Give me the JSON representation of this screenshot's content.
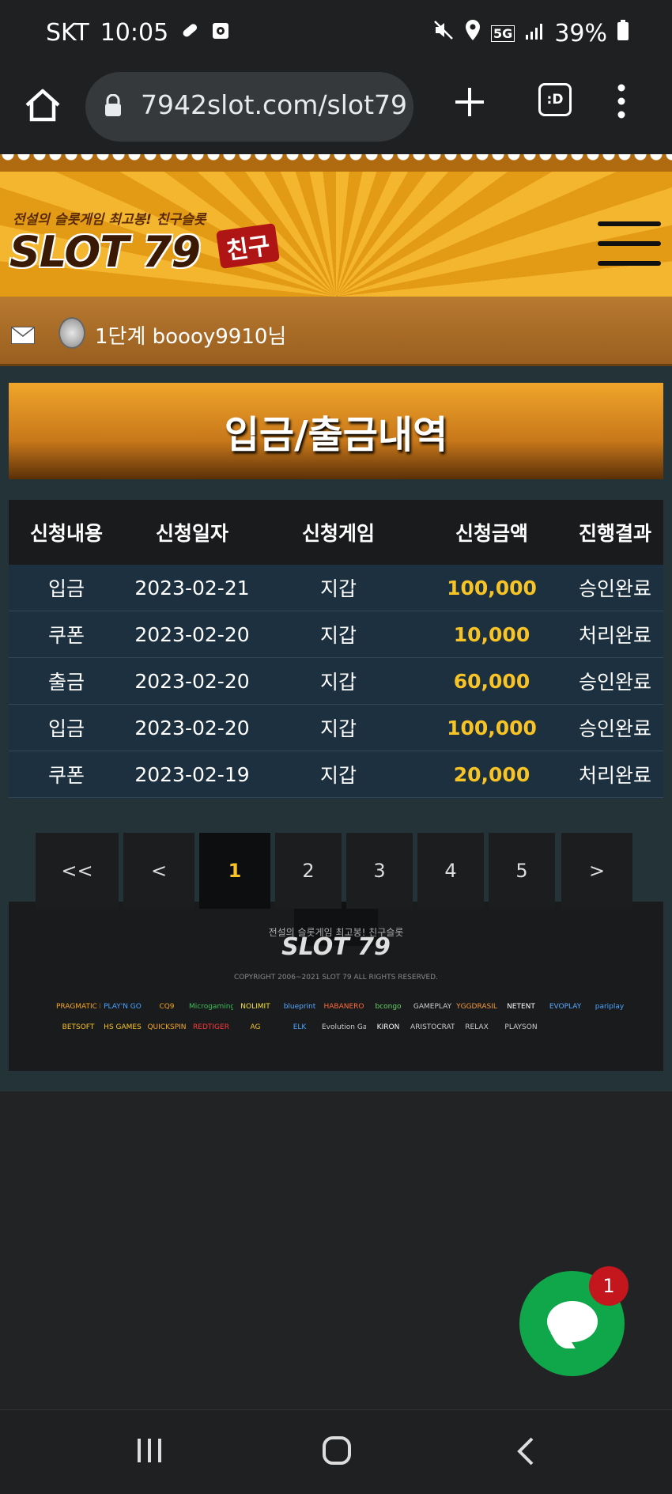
{
  "status_bar": {
    "carrier": "SKT",
    "time": "10:05",
    "network": "5G",
    "battery": "39%"
  },
  "browser": {
    "url": "7942slot.com/slot79",
    "tabs_label": ":D"
  },
  "site": {
    "slogan": "전설의 슬롯게임 최고봉! 친구슬롯",
    "logo_text": "SLOT 79",
    "logo_badge": "친구",
    "user_info": "1단계 boooy9910님"
  },
  "page_title": "입금/출금내역",
  "table": {
    "headers": [
      "신청내용",
      "신청일자",
      "신청게임",
      "신청금액",
      "진행결과"
    ],
    "rows": [
      {
        "type": "입금",
        "date": "2023-02-21",
        "game": "지갑",
        "amount": "100,000",
        "result": "승인완료"
      },
      {
        "type": "쿠폰",
        "date": "2023-02-20",
        "game": "지갑",
        "amount": "10,000",
        "result": "처리완료"
      },
      {
        "type": "출금",
        "date": "2023-02-20",
        "game": "지갑",
        "amount": "60,000",
        "result": "승인완료"
      },
      {
        "type": "입금",
        "date": "2023-02-20",
        "game": "지갑",
        "amount": "100,000",
        "result": "승인완료"
      },
      {
        "type": "쿠폰",
        "date": "2023-02-19",
        "game": "지갑",
        "amount": "20,000",
        "result": "처리완료"
      }
    ]
  },
  "pagination": {
    "first": "<<",
    "prev": "<",
    "pages": [
      "1",
      "2",
      "3",
      "4",
      "5"
    ],
    "next": ">",
    "current": "1"
  },
  "footer": {
    "slogan": "전설의 슬롯게임 최고봉! 친구슬롯",
    "logo": "SLOT 79",
    "copyright": "COPYRIGHT 2006~2021 SLOT 79 ALL RIGHTS RESERVED.",
    "providers": [
      "PRAGMATIC PLAY",
      "PLAY'N GO",
      "CQ9",
      "Microgaming",
      "NOLIMIT",
      "blueprint",
      "HABANERO",
      "bcongo",
      "GAMEPLAY",
      "YGGDRASIL",
      "NETENT",
      "EVOPLAY",
      "pariplay",
      "BETSOFT",
      "HS GAMES",
      "QUICKSPIN",
      "REDTIGER",
      "AG",
      "ELK",
      "Evolution Gaming",
      "KIRON",
      "ARISTOCRAT",
      "RELAX",
      "PLAYSON"
    ]
  },
  "chat": {
    "badge_count": "1"
  },
  "colors": {
    "accent_gold": "#f7c325",
    "chat_green": "#10a64a",
    "badge_red": "#c3161d"
  }
}
